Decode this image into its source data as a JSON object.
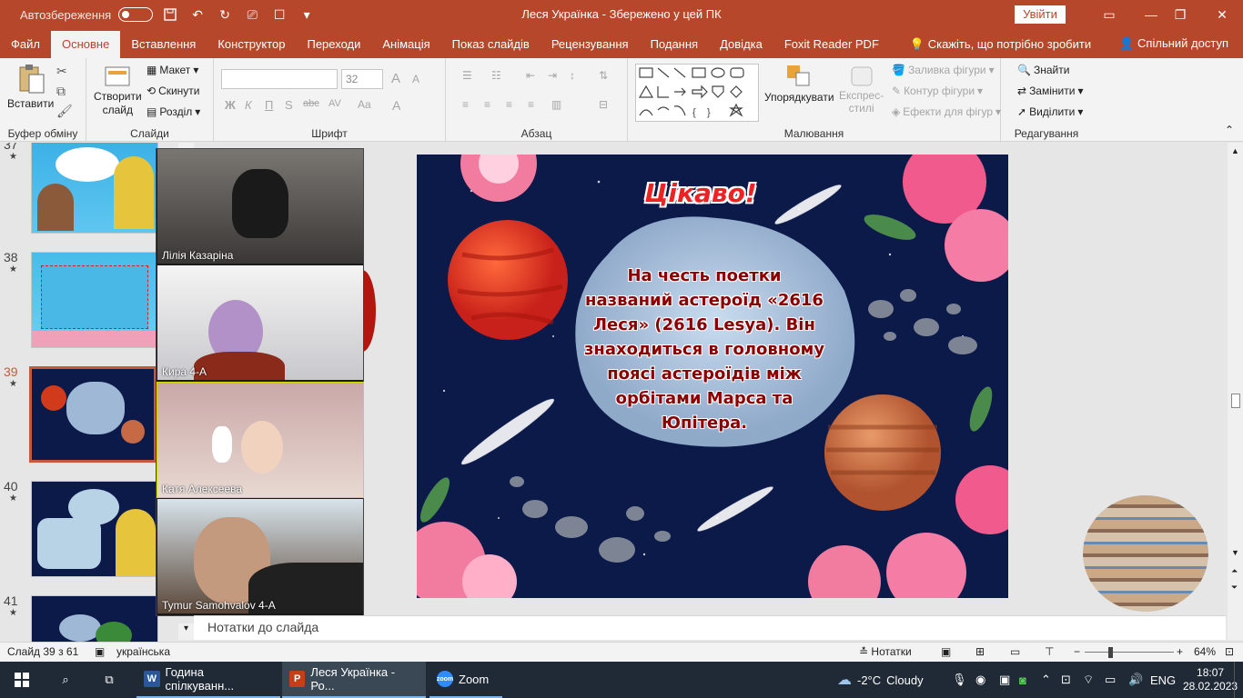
{
  "titlebar": {
    "autosave_label": "Автозбереження",
    "title": "Леся Українка  -  Збережено у цей ПК",
    "signin": "Увійти"
  },
  "tabs": [
    "Файл",
    "Основне",
    "Вставлення",
    "Конструктор",
    "Переходи",
    "Анімація",
    "Показ слайдів",
    "Рецензування",
    "Подання",
    "Довідка",
    "Foxit Reader PDF"
  ],
  "active_tab": "Основне",
  "tellme": "Скажіть, що потрібно зробити",
  "share": "Спільний доступ",
  "ribbon": {
    "clipboard": {
      "label": "Буфер обміну",
      "paste": "Вставити"
    },
    "slides": {
      "label": "Слайди",
      "new_slide_1": "Створити",
      "new_slide_2": "слайд",
      "layout": "Макет",
      "reset": "Скинути",
      "section": "Розділ"
    },
    "font": {
      "label": "Шрифт",
      "size": "32",
      "bold": "Ж",
      "italic": "К",
      "underline": "П",
      "strike": "S",
      "shadow": "abc",
      "spacing": "AV",
      "case": "Aa",
      "color": "A"
    },
    "paragraph": {
      "label": "Абзац"
    },
    "drawing": {
      "label": "Малювання",
      "arrange": "Упорядкувати",
      "quick_styles_1": "Експрес-",
      "quick_styles_2": "стилі",
      "fill": "Заливка фігури",
      "outline": "Контур фігури",
      "effects": "Ефекти для фігур"
    },
    "editing": {
      "label": "Редагування",
      "find": "Знайти",
      "replace": "Замінити",
      "select": "Виділити"
    }
  },
  "thumbnails": [
    {
      "num": "37",
      "star": "★"
    },
    {
      "num": "38",
      "star": "★"
    },
    {
      "num": "39",
      "star": "★"
    },
    {
      "num": "40",
      "star": "★"
    },
    {
      "num": "41",
      "star": "★"
    }
  ],
  "zoom_tiles": [
    "Лілія Казаріна",
    "Кира 4-А",
    "Катя Алексеева",
    "Tymur Samohvalov 4-A"
  ],
  "slide": {
    "title": "Цікаво!",
    "text": "На честь поетки названий астероїд «2616 Леся» (2616 Lesya). Він знаходиться в головному поясі астероїдів між орбітами Марса та Юпітера."
  },
  "notes": "Нотатки до слайда",
  "status": {
    "slide": "Слайд 39 з 61",
    "language": "українська",
    "notes": "Нотатки",
    "zoom": "64%"
  },
  "taskbar": {
    "apps": [
      "Година спілкуванн...",
      "Леся Українка - Ро...",
      "Zoom"
    ],
    "weather_temp": "-2°C",
    "weather_desc": "Cloudy",
    "lang": "ENG",
    "time": "18:07",
    "date": "28.02.2023"
  },
  "colors": {
    "accent": "#b7472a",
    "slide_bg": "#0c1a4a",
    "title_red": "#e22222",
    "text_red": "#8b0000"
  }
}
